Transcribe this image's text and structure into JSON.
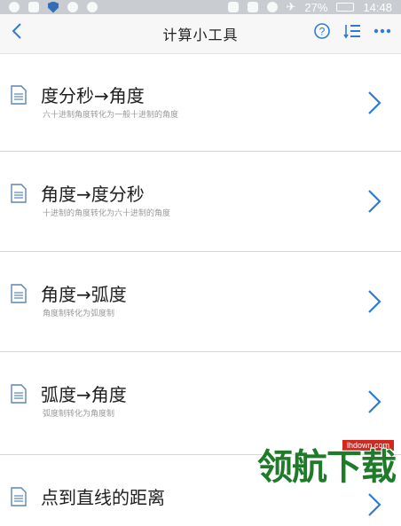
{
  "statusbar": {
    "battery": "27%",
    "time": "14:48"
  },
  "navbar": {
    "title": "计算小工具",
    "icons": [
      "back-chevron-icon",
      "help-icon",
      "sort-list-icon",
      "more-icon"
    ]
  },
  "colors": {
    "accent": "#2e7bd6",
    "title_text": "#1e1e1e",
    "subtitle_text": "#999999",
    "divider": "#d8d8d8",
    "statusbar_bg": "#c9ccd0"
  },
  "tools": [
    {
      "title": "度分秒→角度",
      "subtitle": "六十进制角度转化为一般十进制的角度"
    },
    {
      "title": "角度→度分秒",
      "subtitle": "十进制的角度转化为六十进制的角度"
    },
    {
      "title": "角度→弧度",
      "subtitle": "角度制转化为弧度制"
    },
    {
      "title": "弧度→角度",
      "subtitle": "弧度制转化为角度制"
    },
    {
      "title": "点到直线的距离",
      "subtitle": ""
    }
  ],
  "watermark": {
    "domain": "lhdown.com",
    "logo_text": "领航下载"
  }
}
